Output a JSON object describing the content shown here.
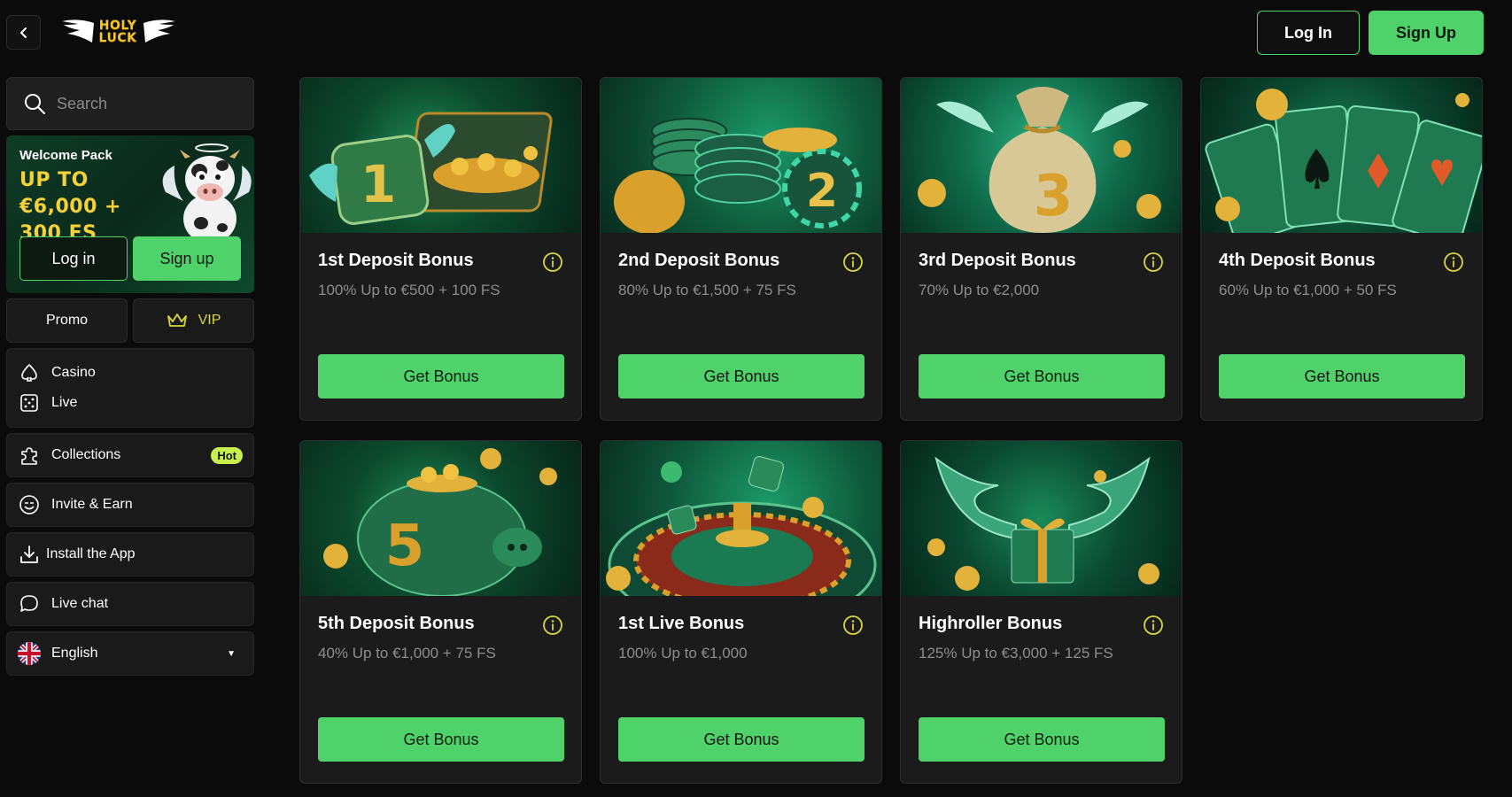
{
  "header": {
    "back_icon": "chevron-left-icon",
    "logo_text": "HOLY LUCK",
    "login_label": "Log In",
    "signup_label": "Sign Up"
  },
  "sidebar": {
    "search_placeholder": "Search",
    "welcome": {
      "title": "Welcome Pack",
      "amount": "UP TO €6,000 + 300 FS",
      "login_label": "Log in",
      "signup_label": "Sign up"
    },
    "promo_label": "Promo",
    "vip_label": "VIP",
    "menu": [
      {
        "label": "Casino",
        "icon": "spade-icon"
      },
      {
        "label": "Live",
        "icon": "dice-icon"
      }
    ],
    "collections_label": "Collections",
    "hot_badge": "Hot",
    "invite_label": "Invite & Earn",
    "install_label": "Install the App",
    "livechat_label": "Live chat",
    "language_label": "English"
  },
  "cards": [
    {
      "title": "1st Deposit Bonus",
      "desc": "100% Up to €500 + 100 FS",
      "button": "Get Bonus"
    },
    {
      "title": "2nd Deposit Bonus",
      "desc": "80% Up to €1,500 + 75 FS",
      "button": "Get Bonus"
    },
    {
      "title": "3rd Deposit Bonus",
      "desc": "70% Up to €2,000",
      "button": "Get Bonus"
    },
    {
      "title": "4th Deposit Bonus",
      "desc": "60% Up to €1,000 + 50 FS",
      "button": "Get Bonus"
    },
    {
      "title": "5th Deposit Bonus",
      "desc": "40% Up to €1,000 + 75 FS",
      "button": "Get Bonus"
    },
    {
      "title": "1st Live Bonus",
      "desc": "100% Up to €1,000",
      "button": "Get Bonus"
    },
    {
      "title": "Highroller Bonus",
      "desc": "125% Up to €3,000 + 125 FS",
      "button": "Get Bonus"
    }
  ],
  "colors": {
    "accent": "#4fd26a",
    "gold": "#f5d23a",
    "background": "#0c0b0b"
  }
}
